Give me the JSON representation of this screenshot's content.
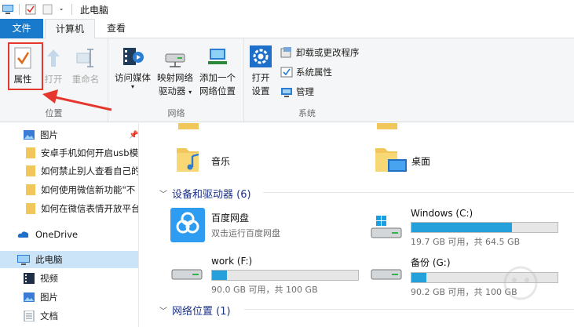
{
  "window": {
    "title": "此电脑"
  },
  "tabs": {
    "file": "文件",
    "computer": "计算机",
    "view": "查看"
  },
  "ribbon": {
    "location": {
      "label": "位置",
      "properties": "属性",
      "open": "打开",
      "rename": "重命名"
    },
    "network": {
      "label": "网络",
      "access_media": "访问媒体",
      "map_drive_line1": "映射网络",
      "map_drive_line2": "驱动器",
      "add_location_line1": "添加一个",
      "add_location_line2": "网络位置"
    },
    "system": {
      "label": "系统",
      "open_settings_line1": "打开",
      "open_settings_line2": "设置",
      "uninstall": "卸载或更改程序",
      "system_properties": "系统属性",
      "manage": "管理"
    }
  },
  "nav": {
    "items": [
      {
        "label": "图片",
        "icon": "pictures-icon",
        "pinned": true
      },
      {
        "label": "安卓手机如何开启usb模",
        "icon": "folder-icon"
      },
      {
        "label": "如何禁止别人查看自己的",
        "icon": "folder-icon"
      },
      {
        "label": "如何使用微信新功能\"不",
        "icon": "folder-icon"
      },
      {
        "label": "如何在微信表情开放平台",
        "icon": "folder-icon"
      },
      {
        "label": "OneDrive",
        "icon": "onedrive-icon"
      },
      {
        "label": "此电脑",
        "icon": "computer-icon",
        "selected": true
      },
      {
        "label": "视频",
        "icon": "videos-icon"
      },
      {
        "label": "图片",
        "icon": "pictures-icon"
      },
      {
        "label": "文档",
        "icon": "documents-icon"
      }
    ]
  },
  "content": {
    "folders": [
      {
        "name": "音乐",
        "icon": "music-folder-icon"
      },
      {
        "name": "桌面",
        "icon": "desktop-folder-icon"
      }
    ],
    "devices_header": "设备和驱动器 (6)",
    "devices": [
      {
        "name": "百度网盘",
        "sub": "双击运行百度网盘",
        "icon": "baidu-netdisk-icon"
      },
      {
        "name": "Windows (C:)",
        "sub": "19.7 GB 可用，共 64.5 GB",
        "icon": "windows-drive-icon",
        "used_fraction": 0.69
      },
      {
        "name": "work (F:)",
        "sub": "90.0 GB 可用，共 100 GB",
        "icon": "drive-icon",
        "used_fraction": 0.1
      },
      {
        "name": "备份 (G:)",
        "sub": "90.2 GB 可用，共 100 GB",
        "icon": "drive-icon",
        "used_fraction": 0.1
      }
    ],
    "network_header": "网络位置 (1)"
  },
  "colors": {
    "accent": "#1979ca",
    "bar": "#26a0da",
    "highlight": "#e5372d",
    "section": "#1e3287"
  }
}
